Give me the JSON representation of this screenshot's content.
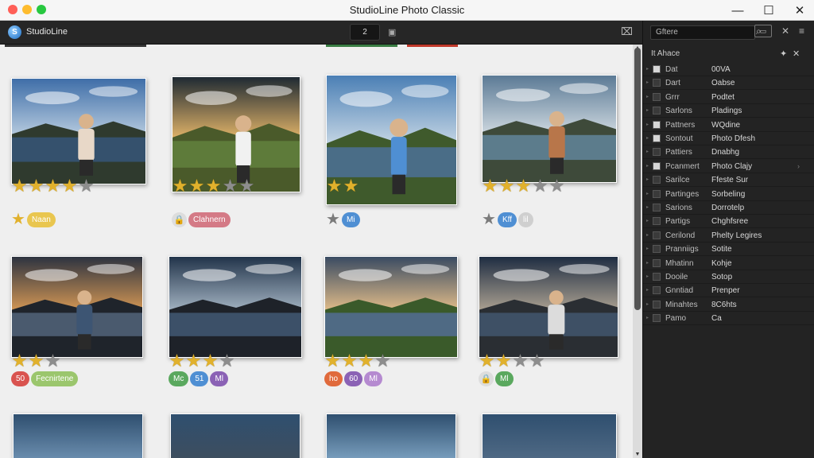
{
  "window": {
    "title": "StudioLine Photo Classic",
    "minimize": "—",
    "maximize": "☐",
    "close": "✕"
  },
  "toolbar": {
    "app_name": "StudioLine",
    "page_number": "2",
    "tool_icon": "⌧"
  },
  "panel": {
    "search_value": "Gftere",
    "header_title": "It Ahace",
    "rows": [
      {
        "key": "Dat",
        "value": "00VA"
      },
      {
        "key": "Dart",
        "value": "Oabse"
      },
      {
        "key": "Grrr",
        "value": "Podtet"
      },
      {
        "key": "Sarlons",
        "value": "Pladings"
      },
      {
        "key": "Pattners",
        "value": "WQdine"
      },
      {
        "key": "Sontout",
        "value": "Photo Dfesh"
      },
      {
        "key": "Pattiers",
        "value": "Dnabhg"
      },
      {
        "key": "Pcanmert",
        "value": "Photo Clajy"
      },
      {
        "key": "Sarilce",
        "value": "Ffeste Sur"
      },
      {
        "key": "Partinges",
        "value": "Sorbeling"
      },
      {
        "key": "Sarions",
        "value": "Dorrotelp"
      },
      {
        "key": "Partigs",
        "value": "Chghfsree"
      },
      {
        "key": "Cerilond",
        "value": "Phelty Legires"
      },
      {
        "key": "Pranniigs",
        "value": "Sotite"
      },
      {
        "key": "Mhatinn",
        "value": "Kohje"
      },
      {
        "key": "Dooile",
        "value": "Sotop"
      },
      {
        "key": "Gnntiad",
        "value": "Prenper"
      },
      {
        "key": "Minahtes",
        "value": "8C6hts"
      },
      {
        "key": "Pamo",
        "value": "Ca"
      }
    ]
  },
  "gallery": {
    "photos": [
      {
        "scene": "lake-girl",
        "stars": 5,
        "rated": 4,
        "tags": [
          {
            "text": "Naan",
            "color": "#e9c64f"
          }
        ],
        "tag_icon": "star"
      },
      {
        "scene": "sun-man",
        "stars": 5,
        "rated": 3,
        "tags": [
          {
            "text": "Clahnern",
            "color": "#d47a86"
          }
        ],
        "tag_icon": "lock"
      },
      {
        "scene": "boy-lake",
        "stars": 2,
        "rated": 2,
        "tags": [
          {
            "text": "Mi",
            "color": "#4f8fd3"
          }
        ],
        "tag_icon": "star-grey"
      },
      {
        "scene": "mountain-woman",
        "stars": 5,
        "rated": 3,
        "tags": [
          {
            "text": "Kff",
            "color": "#4f8fd3"
          },
          {
            "text": "lil",
            "color": "#cfcfcf"
          }
        ],
        "tag_icon": "star-grey"
      },
      {
        "scene": "frame-man",
        "stars": 3,
        "rated": 2,
        "tags": [
          {
            "text": "50",
            "color": "#d9534f"
          },
          {
            "text": "Fecnirtene",
            "color": "#9bc66d"
          }
        ],
        "tag_icon": ""
      },
      {
        "scene": "sunset-lake",
        "stars": 4,
        "rated": 3,
        "tags": [
          {
            "text": "Mc",
            "color": "#5aa85e"
          },
          {
            "text": "51",
            "color": "#4f8fd3"
          },
          {
            "text": "Ml",
            "color": "#8b62b5"
          }
        ],
        "tag_icon": ""
      },
      {
        "scene": "field-sunset",
        "stars": 4,
        "rated": 3,
        "tags": [
          {
            "text": "ho",
            "color": "#e06a3c"
          },
          {
            "text": "60",
            "color": "#8b62b5"
          },
          {
            "text": "Ml",
            "color": "#b58ad0"
          }
        ],
        "tag_icon": ""
      },
      {
        "scene": "girl-sunset",
        "stars": 4,
        "rated": 2,
        "tags": [
          {
            "text": "Ml",
            "color": "#5aa85e"
          }
        ],
        "tag_icon": "lock"
      }
    ]
  }
}
